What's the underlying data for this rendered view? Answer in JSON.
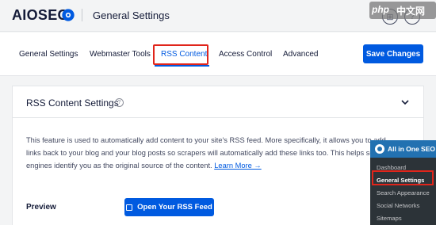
{
  "header": {
    "logo_text": "AIOSEO",
    "page_title": "General Settings"
  },
  "watermark": {
    "logo": "php",
    "text": "中文网"
  },
  "tabs": [
    {
      "label": "General Settings",
      "active": false
    },
    {
      "label": "Webmaster Tools",
      "active": false
    },
    {
      "label": "RSS Content",
      "active": true
    },
    {
      "label": "Access Control",
      "active": false
    },
    {
      "label": "Advanced",
      "active": false
    }
  ],
  "toolbar": {
    "save_label": "Save Changes"
  },
  "card": {
    "title": "RSS Content Settings",
    "description": "This feature is used to automatically add content to your site's RSS feed. More specifically, it allows you to add links back to your blog and your blog posts so scrapers will automatically add these links too. This helps search engines identify you as the original source of the content.",
    "learn_more": "Learn More →",
    "preview_label": "Preview",
    "open_feed_label": "Open Your RSS Feed"
  },
  "wp_menu": {
    "title": "All in One SEO",
    "items": [
      {
        "label": "Dashboard",
        "current": false
      },
      {
        "label": "General Settings",
        "current": true
      },
      {
        "label": "Search Appearance",
        "current": false
      },
      {
        "label": "Social Networks",
        "current": false
      },
      {
        "label": "Sitemaps",
        "current": false
      }
    ]
  },
  "colors": {
    "accent": "#005ae0",
    "highlight": "#e0251b",
    "wp_admin_bg": "#1d2327",
    "wp_admin_accent": "#2271b1"
  },
  "icons": [
    "gear-icon",
    "help-icon",
    "chevron-down-icon",
    "external-link-icon",
    "wordpress-icon"
  ]
}
